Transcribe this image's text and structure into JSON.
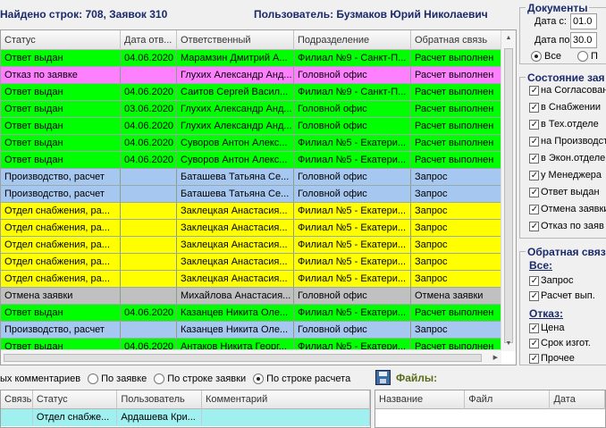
{
  "header": {
    "found_text": "Найдено строк: 708, Заявок 310",
    "user_text": "Пользователь: Бузмаков Юрий Николаевич"
  },
  "main_grid": {
    "columns": [
      "Статус",
      "Дата отв...",
      "Ответственный",
      "Подразделение",
      "Обратная связь"
    ],
    "rows": [
      {
        "color": "green",
        "cells": [
          "Ответ выдан",
          "04.06.2020",
          "Марамзин Дмитрий А...",
          "Филиал №9 - Санкт-П...",
          "Расчет выполнен"
        ]
      },
      {
        "color": "pink",
        "cells": [
          "Отказ по заявке",
          "",
          "Глухих Александр Анд...",
          "Головной офис",
          "Расчет выполнен"
        ]
      },
      {
        "color": "green",
        "cells": [
          "Ответ выдан",
          "04.06.2020",
          "Саитов Сергей Васил...",
          "Филиал №9 - Санкт-П...",
          "Расчет выполнен"
        ]
      },
      {
        "color": "green",
        "cells": [
          "Ответ выдан",
          "03.06.2020",
          "Глухих Александр Анд...",
          "Головной офис",
          "Расчет выполнен"
        ]
      },
      {
        "color": "green",
        "cells": [
          "Ответ выдан",
          "04.06.2020",
          "Глухих Александр Анд...",
          "Головной офис",
          "Расчет выполнен"
        ]
      },
      {
        "color": "green",
        "cells": [
          "Ответ выдан",
          "04.06.2020",
          "Суворов Антон Алекс...",
          "Филиал №5 - Екатери...",
          "Расчет выполнен"
        ]
      },
      {
        "color": "green",
        "cells": [
          "Ответ выдан",
          "04.06.2020",
          "Суворов Антон Алекс...",
          "Филиал №5 - Екатери...",
          "Расчет выполнен"
        ]
      },
      {
        "color": "blue",
        "cells": [
          "Производство, расчет",
          "",
          "Баташева Татьяна Се...",
          "Головной офис",
          "Запрос"
        ]
      },
      {
        "color": "blue",
        "cells": [
          "Производство, расчет",
          "",
          "Баташева Татьяна Се...",
          "Головной офис",
          "Запрос"
        ]
      },
      {
        "color": "yellow",
        "cells": [
          "Отдел снабжения, ра...",
          "",
          "Заклецкая Анастасия...",
          "Филиал №5 - Екатери...",
          "Запрос"
        ]
      },
      {
        "color": "yellow",
        "cells": [
          "Отдел снабжения, ра...",
          "",
          "Заклецкая Анастасия...",
          "Филиал №5 - Екатери...",
          "Запрос"
        ]
      },
      {
        "color": "yellow",
        "cells": [
          "Отдел снабжения, ра...",
          "",
          "Заклецкая Анастасия...",
          "Филиал №5 - Екатери...",
          "Запрос"
        ]
      },
      {
        "color": "yellow",
        "cells": [
          "Отдел снабжения, ра...",
          "",
          "Заклецкая Анастасия...",
          "Филиал №5 - Екатери...",
          "Запрос"
        ]
      },
      {
        "color": "yellow",
        "cells": [
          "Отдел снабжения, ра...",
          "",
          "Заклецкая Анастасия...",
          "Филиал №5 - Екатери...",
          "Запрос"
        ]
      },
      {
        "color": "gray",
        "cells": [
          "Отмена заявки",
          "",
          "Михайлова Анастасия...",
          "Головной офис",
          "Отмена заявки"
        ]
      },
      {
        "color": "green",
        "cells": [
          "Ответ выдан",
          "04.06.2020",
          "Казанцев Никита Оле...",
          "Филиал №5 - Екатери...",
          "Расчет выполнен"
        ]
      },
      {
        "color": "blue",
        "cells": [
          "Производство, расчет",
          "",
          "Казанцев Никита Оле...",
          "Головной офис",
          "Запрос"
        ]
      },
      {
        "color": "green",
        "cells": [
          "Ответ выдан",
          "04.06.2020",
          "Антаков Никита Георг...",
          "Филиал №5 - Екатери...",
          "Расчет выполнен"
        ]
      }
    ]
  },
  "comments_options": {
    "prefix": "ых комментариев",
    "options": [
      "По заявке",
      "По строке заявки",
      "По строке расчета"
    ],
    "selected": 2
  },
  "comments_grid": {
    "columns": [
      "Связь",
      "Статус",
      "Пользователь",
      "Комментарий"
    ],
    "rows": [
      [
        "",
        "Отдел снабже...",
        "Ардашева Кри...",
        ""
      ]
    ]
  },
  "files": {
    "title": "Файлы:",
    "columns": [
      "Название",
      "Файл",
      "Дата"
    ]
  },
  "right_panel": {
    "docs": {
      "title": "Документы",
      "date_from_label": "Дата с:",
      "date_from_value": "01.0",
      "date_to_label": "Дата по:",
      "date_to_value": "30.0",
      "radio_all": "Все",
      "radio_other": "П"
    },
    "state": {
      "title": "Состояние зая",
      "items": [
        "на Согласован",
        "в Снабжении",
        "в Тех.отделе",
        "на Производств",
        "в Экон.отделе",
        "у Менеджера",
        "Ответ выдан",
        "Отмена заявки",
        "Отказ по заяв"
      ]
    },
    "feedback": {
      "title": "Обратная связ",
      "all_label": "Все:",
      "all_items": [
        "Запрос",
        "Расчет вып."
      ],
      "refuse_label": "Отказ:",
      "refuse_items": [
        "Цена",
        "Срок изгот.",
        "Прочее"
      ]
    }
  }
}
